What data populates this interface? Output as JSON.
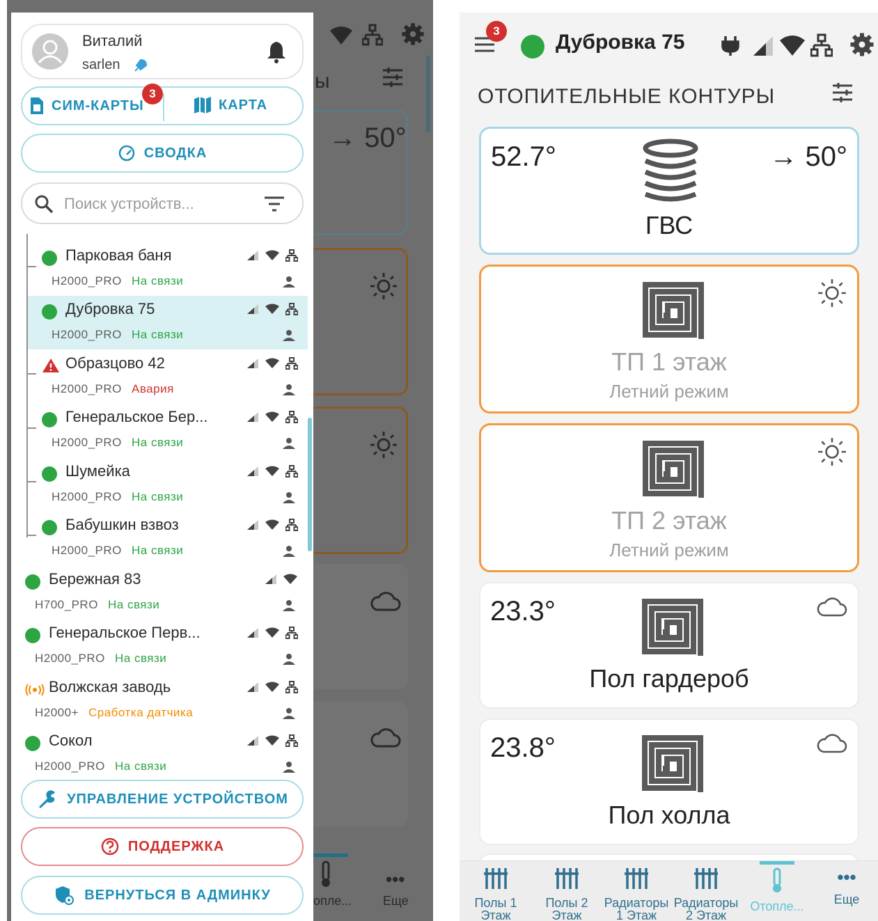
{
  "drawer": {
    "user": {
      "name": "Виталий",
      "login": "sarlen"
    },
    "sim_label": "СИМ-КАРТЫ",
    "sim_badge": "3",
    "map_label": "КАРТА",
    "summary_label": "СВОДКА",
    "search_placeholder": "Поиск устройств...",
    "devices": [
      {
        "name": "Парковая баня",
        "model": "H2000_PRO",
        "status": "На связи",
        "state": "ok"
      },
      {
        "name": "Дубровка 75",
        "model": "H2000_PRO",
        "status": "На связи",
        "state": "ok",
        "selected": true
      },
      {
        "name": "Образцово 42",
        "model": "H2000_PRO",
        "status": "Авария",
        "state": "alarm"
      },
      {
        "name": "Генеральское Бер...",
        "model": "H2000_PRO",
        "status": "На связи",
        "state": "ok"
      },
      {
        "name": "Шумейка",
        "model": "H2000_PRO",
        "status": "На связи",
        "state": "ok"
      },
      {
        "name": "Бабушкин взвоз",
        "model": "H2000_PRO",
        "status": "На связи",
        "state": "ok"
      },
      {
        "name": "Бережная 83",
        "model": "H700_PRO",
        "status": "На связи",
        "state": "ok"
      },
      {
        "name": "Генеральское Перв...",
        "model": "H2000_PRO",
        "status": "На связи",
        "state": "ok"
      },
      {
        "name": "Волжская заводь",
        "model": "H2000+",
        "status": "Сработка датчика",
        "state": "sensor"
      },
      {
        "name": "Сокол",
        "model": "H2000_PRO",
        "status": "На связи",
        "state": "ok"
      }
    ],
    "manage_label": "УПРАВЛЕНИЕ УСТРОЙСТВОМ",
    "support_label": "ПОДДЕРЖКА",
    "admin_label": "ВЕРНУТЬСЯ В АДМИНКУ"
  },
  "background": {
    "partial_heading": "ы",
    "target": "→ 50°",
    "nav_heating": "опле...",
    "nav_more": "Еще"
  },
  "main": {
    "menu_badge": "3",
    "device_title": "Дубровка 75",
    "section_title": "ОТОПИТЕЛЬНЫЕ КОНТУРЫ",
    "cards": [
      {
        "name": "ГВС",
        "temp": "52.7°",
        "target": "→ 50°",
        "icon": "coil-icon"
      },
      {
        "name": "ТП 1 этаж",
        "sub": "Летний режим",
        "icon": "floor-heating-icon",
        "corner": "sun-icon"
      },
      {
        "name": "ТП 2 этаж",
        "sub": "Летний режим",
        "icon": "floor-heating-icon",
        "corner": "sun-icon"
      },
      {
        "name": "Пол гардероб",
        "temp": "23.3°",
        "icon": "floor-heating-icon",
        "corner": "cloud-icon"
      },
      {
        "name": "Пол холла",
        "temp": "23.8°",
        "icon": "floor-heating-icon",
        "corner": "cloud-icon"
      }
    ],
    "nav": [
      {
        "line1": "Полы 1",
        "line2": "Этаж"
      },
      {
        "line1": "Полы 2",
        "line2": "Этаж"
      },
      {
        "line1": "Радиаторы",
        "line2": "1 Этаж"
      },
      {
        "line1": "Радиаторы",
        "line2": "2 Этаж"
      },
      {
        "line1": "Отопле..."
      },
      {
        "line1": "Еще"
      }
    ]
  },
  "colors": {
    "accent": "#1f8fb8",
    "online": "#2ea543",
    "alarm": "#d32f2f",
    "sensor": "#f28c00",
    "orange_border": "#f39a3f"
  }
}
